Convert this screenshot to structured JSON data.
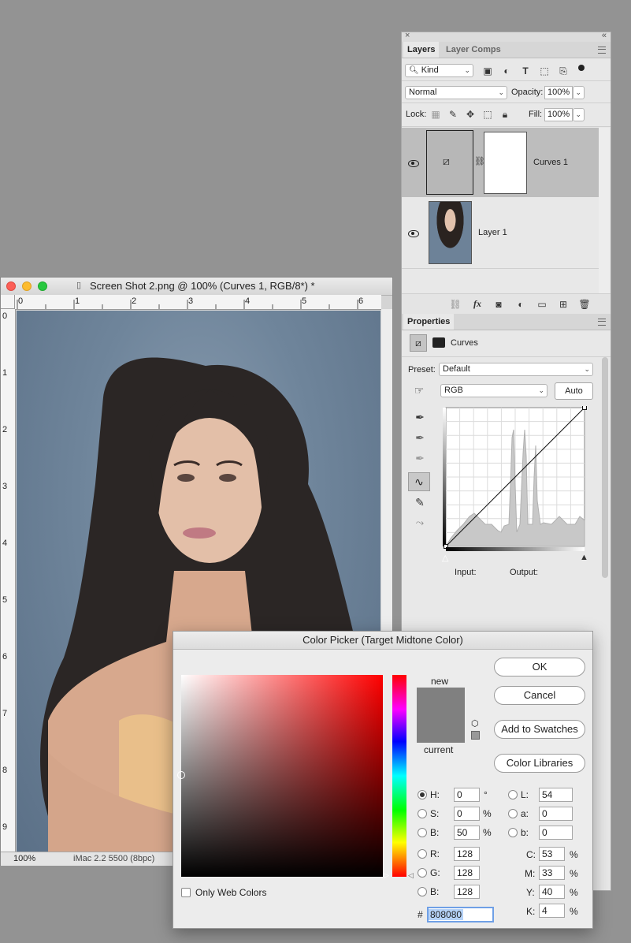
{
  "layers_panel": {
    "tabs": [
      "Layers",
      "Layer Comps"
    ],
    "filter": {
      "label": "Kind"
    },
    "blend_mode": "Normal",
    "opacity_label": "Opacity:",
    "opacity_value": "100%",
    "lock_label": "Lock:",
    "fill_label": "Fill:",
    "fill_value": "100%",
    "layers": [
      {
        "name": "Curves 1",
        "selected": true,
        "visible": true
      },
      {
        "name": "Layer 1",
        "selected": false,
        "visible": true
      }
    ]
  },
  "properties_panel": {
    "title": "Properties",
    "adjustment": "Curves",
    "preset_label": "Preset:",
    "preset_value": "Default",
    "channel_value": "RGB",
    "auto_label": "Auto",
    "input_label": "Input:",
    "output_label": "Output:"
  },
  "document": {
    "title": "Screen Shot 2.png @ 100% (Curves 1, RGB/8*) *",
    "ruler_h": [
      "0",
      "1",
      "2",
      "3",
      "4",
      "5",
      "6"
    ],
    "ruler_v": [
      "0",
      "1",
      "2",
      "3",
      "4",
      "5",
      "6",
      "7",
      "8",
      "9"
    ],
    "zoom": "100%",
    "profile": "iMac 2.2 5500 (8bpc)"
  },
  "color_picker": {
    "title": "Color Picker (Target Midtone Color)",
    "new_label": "new",
    "current_label": "current",
    "swatch_color": "#808080",
    "buttons": {
      "ok": "OK",
      "cancel": "Cancel",
      "add_to_swatches": "Add to Swatches",
      "color_libraries": "Color Libraries"
    },
    "only_web_colors": "Only Web Colors",
    "fields": {
      "H": {
        "label": "H:",
        "value": "0",
        "unit": "°"
      },
      "S": {
        "label": "S:",
        "value": "0",
        "unit": "%"
      },
      "B": {
        "label": "B:",
        "value": "50",
        "unit": "%"
      },
      "R": {
        "label": "R:",
        "value": "128"
      },
      "G": {
        "label": "G:",
        "value": "128"
      },
      "Bl": {
        "label": "B:",
        "value": "128"
      },
      "L": {
        "label": "L:",
        "value": "54"
      },
      "a": {
        "label": "a:",
        "value": "0"
      },
      "b": {
        "label": "b:",
        "value": "0"
      },
      "C": {
        "label": "C:",
        "value": "53",
        "unit": "%"
      },
      "M": {
        "label": "M:",
        "value": "33",
        "unit": "%"
      },
      "Y": {
        "label": "Y:",
        "value": "40",
        "unit": "%"
      },
      "K": {
        "label": "K:",
        "value": "4",
        "unit": "%"
      }
    },
    "hex_label": "#",
    "hex_value": "808080"
  }
}
